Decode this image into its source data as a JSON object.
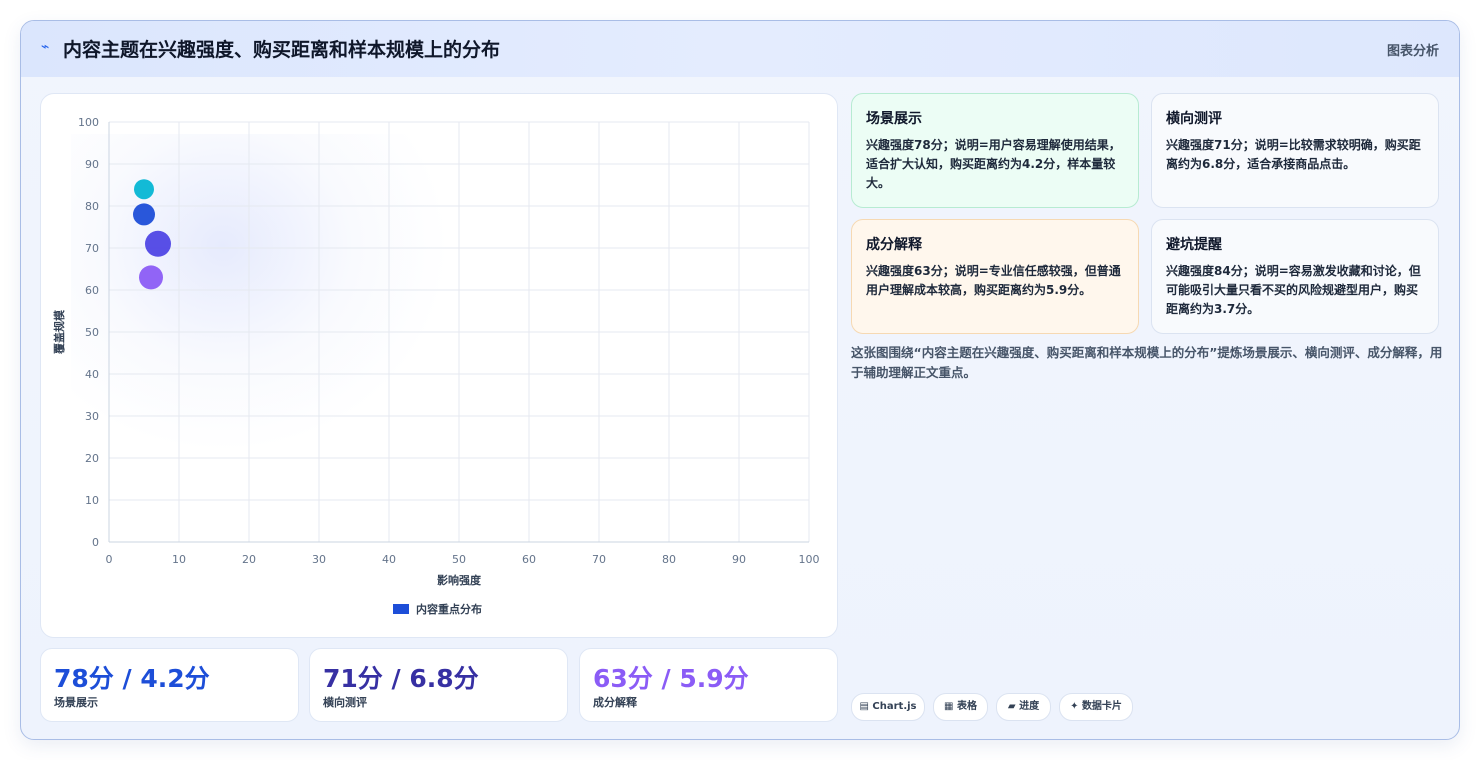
{
  "header": {
    "icon": "lightning-icon",
    "title": "内容主题在兴趣强度、购买距离和样本规模上的分布",
    "tag": "图表分析"
  },
  "chart_data": {
    "type": "bubble",
    "xlabel": "影响强度",
    "ylabel": "覆盖规模",
    "xlim": [
      0,
      100
    ],
    "ylim": [
      0,
      100
    ],
    "x_ticks": [
      "0",
      "10",
      "20",
      "30",
      "40",
      "50",
      "60",
      "70",
      "80",
      "90",
      "100"
    ],
    "y_ticks": [
      "0",
      "10",
      "20",
      "30",
      "40",
      "50",
      "60",
      "70",
      "80",
      "90",
      "100"
    ],
    "grid": true,
    "legend": {
      "placement": "bottom",
      "label": "内容重点分布",
      "color": "#1d4ed8"
    },
    "series": [
      {
        "name": "内容重点分布",
        "points": [
          {
            "x": 5,
            "y": 84,
            "r": 10,
            "color": "#06b6d4"
          },
          {
            "x": 5,
            "y": 78,
            "r": 11,
            "color": "#1d4ed8"
          },
          {
            "x": 7,
            "y": 71,
            "r": 13,
            "color": "#4f46e5"
          },
          {
            "x": 6,
            "y": 63,
            "r": 12,
            "color": "#8b5cf6"
          }
        ]
      }
    ]
  },
  "metrics": [
    {
      "value": "78分 / 4.2分",
      "label": "场景展示",
      "color": "#1d4ed8"
    },
    {
      "value": "71分 / 6.8分",
      "label": "横向测评",
      "color": "#3730a3"
    },
    {
      "value": "63分 / 5.9分",
      "label": "成分解释",
      "color": "#8b5cf6"
    }
  ],
  "cards": [
    {
      "title": "场景展示",
      "text": "兴趣强度78分；说明=用户容易理解使用结果，适合扩大认知，购买距离约为4.2分，样本量较大。",
      "bg": "#ecfdf5",
      "border": "#b7ebd2"
    },
    {
      "title": "横向测评",
      "text": "兴趣强度71分；说明=比较需求较明确，购买距离约为6.8分，适合承接商品点击。",
      "bg": "#f8fafd",
      "border": "#dbe3f1"
    },
    {
      "title": "成分解释",
      "text": "兴趣强度63分；说明=专业信任感较强，但普通用户理解成本较高，购买距离约为5.9分。",
      "bg": "#fff7ed",
      "border": "#f6d9b3"
    },
    {
      "title": "避坑提醒",
      "text": "兴趣强度84分；说明=容易激发收藏和讨论，但可能吸引大量只看不买的风险规避型用户，购买距离约为3.7分。",
      "bg": "#f8fafd",
      "border": "#dbe3f1"
    }
  ],
  "summary": "这张图围绕“内容主题在兴趣强度、购买距离和样本规模上的分布”提炼场景展示、横向测评、成分解释，用于辅助理解正文重点。",
  "pills": [
    {
      "icon": "chart-icon",
      "glyph": "▤",
      "label": "Chart.js"
    },
    {
      "icon": "table-icon",
      "glyph": "▦",
      "label": "表格"
    },
    {
      "icon": "progress-icon",
      "glyph": "▰",
      "label": "进度"
    },
    {
      "icon": "sparkle-icon",
      "glyph": "✦",
      "label": "数据卡片"
    }
  ]
}
